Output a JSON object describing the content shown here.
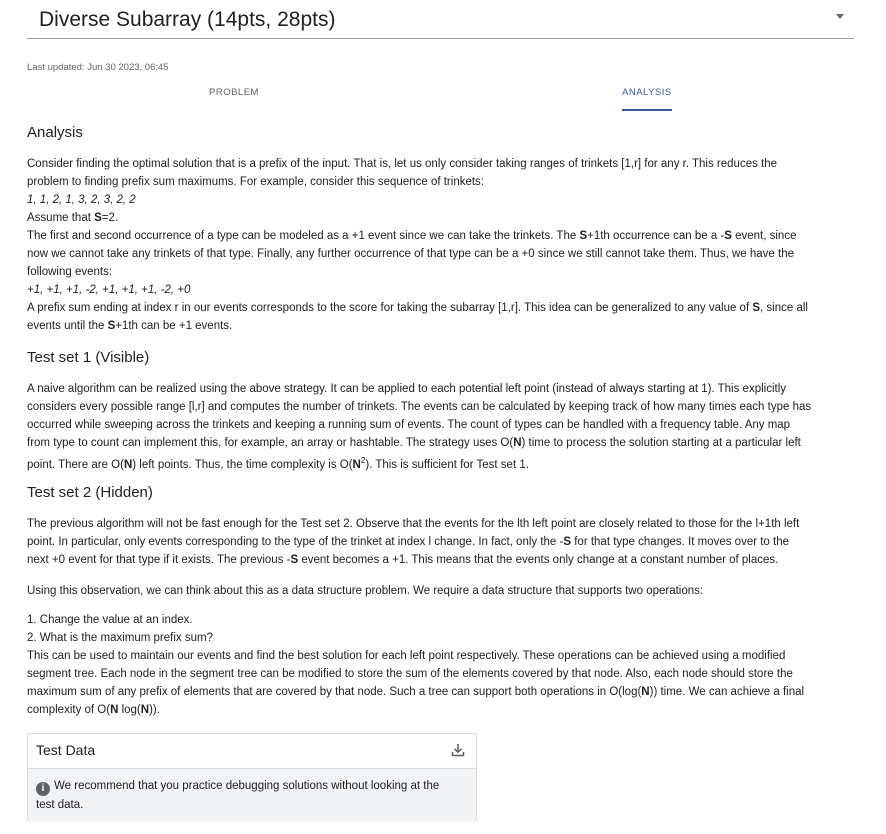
{
  "header": {
    "title": "Diverse Subarray (14pts, 28pts)"
  },
  "last_updated": "Last updated: Jun 30 2023, 06:45",
  "tabs": {
    "problem": "PROBLEM",
    "analysis": "ANALYSIS"
  },
  "analysis": {
    "heading": "Analysis",
    "p1a": "Consider finding the optimal solution that is a prefix of the input. That is, let us only consider taking ranges of trinkets [1,r] for any r. This reduces the",
    "p1b": "problem to finding prefix sum maximums. For example, consider this sequence of trinkets:",
    "seq": "1, 1, 2, 1, 3, 2, 3, 2, 2",
    "assume_pre": "Assume that ",
    "assume_b": "S",
    "assume_post": "=2.",
    "p2a_1": "The first and second occurrence of a type can be modeled as a +1 event since we can take the trinkets. The ",
    "p2a_b1": "S",
    "p2a_2": "+1th occurrence can be a -",
    "p2a_b2": "S",
    "p2a_3": " event, since",
    "p2b": "now we cannot take any trinkets of that type. Finally, any further occurrence of that type can be a +0 since we still cannot take them. Thus, we have the",
    "p2c": "following events:",
    "events": "+1, +1, +1, -2, +1, +1, +1, -2, +0",
    "p3a_1": "A prefix sum ending at index r in our events corresponds to the score for taking the subarray [1,r]. This idea can be generalized to any value of ",
    "p3a_b": "S",
    "p3a_2": ", since all",
    "p3b_1": "events until the ",
    "p3b_b": "S",
    "p3b_2": "+1th can be +1 events."
  },
  "ts1": {
    "heading": "Test set 1 (Visible)",
    "l1": "A naive algorithm can be realized using the above strategy. It can be applied to each potential left point (instead of always starting at 1). This explicitly",
    "l2": "considers every possible range [l,r] and computes the number of trinkets. The events can be calculated by keeping track of how many times each type has",
    "l3": "occurred while sweeping across the trinkets and keeping a running sum of events. The count of types can be handled with a frequency table. Any map",
    "l4_1": "from type to count can implement this, for example, an array or hashtable. The strategy uses O(",
    "l4_b": "N",
    "l4_2": ") time to process the solution starting at a particular left",
    "l5_1": "point. There are O(",
    "l5_b1": "N",
    "l5_2": ") left points. Thus, the time complexity is O(",
    "l5_b2": "N",
    "l5_sup": "2",
    "l5_3": "). This is sufficient for Test set 1."
  },
  "ts2": {
    "heading": "Test set 2 (Hidden)",
    "l1": "The previous algorithm will not be fast enough for the Test set 2. Observe that the events for the lth left point are closely related to those for the l+1th left",
    "l2_1": "point. In particular, only events corresponding to the type of the trinket at index l change. In fact, only the -",
    "l2_b": "S",
    "l2_2": " for that type changes. It moves over to the",
    "l3_1": "next +0 event for that type if it exists. The previous -",
    "l3_b": "S",
    "l3_2": " event becomes a +1. This means that the events only change at a constant number of places.",
    "p2": "Using this observation, we can think about this as a data structure problem. We require a data structure that supports two operations:",
    "op1": "1. Change the value at an index.",
    "op2": "2. What is the maximum prefix sum?",
    "c1": "This can be used to maintain our events and find the best solution for each left point respectively. These operations can be achieved using a modified",
    "c2": "segment tree. Each node in the segment tree can be modified to store the sum of the elements covered by that node. Also, each node should store the",
    "c3_1": "maximum sum of any prefix of elements that are covered by that node. Such a tree can support both operations in O(log(",
    "c3_b": "N",
    "c3_2": ")) time. We can achieve a final",
    "c4_1": "complexity of O(",
    "c4_b1": "N",
    "c4_2": " log(",
    "c4_b2": "N",
    "c4_3": "))."
  },
  "test_data": {
    "title": "Test Data",
    "note_1": "We recommend that you practice debugging solutions without looking at the",
    "note_2": "test data.",
    "info_glyph": "i"
  }
}
